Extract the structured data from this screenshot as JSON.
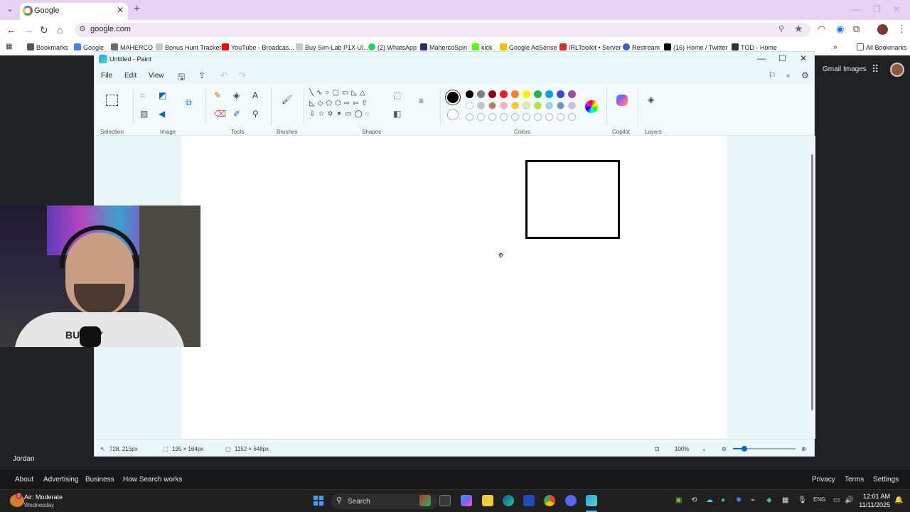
{
  "browser": {
    "tab_title": "Google",
    "url": "google.com",
    "bookmarks": [
      {
        "label": "Bookmarks",
        "color": "#555555"
      },
      {
        "label": "Google",
        "color": "#4285f4"
      },
      {
        "label": "MAHERCO",
        "color": "#6c6c6c"
      },
      {
        "label": "Bonus Hunt Tracker",
        "color": "#c9c9c9"
      },
      {
        "label": "YouTube - Broadcas...",
        "color": "#ff0000"
      },
      {
        "label": "Buy Sim-Lab P1X Ul...",
        "color": "#c9c9c9"
      },
      {
        "label": "(2) WhatsApp",
        "color": "#25d366"
      },
      {
        "label": "MahercoSpin",
        "color": "#2b2b6e"
      },
      {
        "label": "kick",
        "color": "#53fc18"
      },
      {
        "label": "Google AdSense",
        "color": "#fbbc05"
      },
      {
        "label": "IRLToolkit • Server",
        "color": "#d82c2c"
      },
      {
        "label": "Restream",
        "color": "#3b5bdb"
      },
      {
        "label": "(16) Home / Twitter",
        "color": "#000000"
      },
      {
        "label": "TOD - Home",
        "color": "#333333"
      }
    ],
    "all_bookmarks": "All Bookmarks"
  },
  "google": {
    "gmail": "Gmail",
    "images": "Images",
    "location": "Jordan",
    "footer_left": [
      "About",
      "Advertising",
      "Business",
      "How Search works"
    ],
    "footer_right": [
      "Privacy",
      "Terms",
      "Settings"
    ]
  },
  "paint": {
    "title": "Untitled - Paint",
    "menu": [
      "File",
      "Edit",
      "View"
    ],
    "groups": [
      "Selection",
      "Image",
      "Tools",
      "Brushes",
      "Shapes",
      "Colors",
      "Copilot",
      "Layers"
    ],
    "palette_row1": [
      "#000000",
      "#7f7f7f",
      "#880015",
      "#ed1c24",
      "#ff7f27",
      "#fff200",
      "#22b14c",
      "#00a2e8",
      "#3f48cc",
      "#a349a4"
    ],
    "palette_row2": [
      "#ffffff",
      "#c3c3c3",
      "#b97a57",
      "#ffaec9",
      "#ffc90e",
      "#efe4b0",
      "#b5e61d",
      "#99d9ea",
      "#7092be",
      "#c8bfe7"
    ],
    "status": {
      "cursor_pos": "728, 215px",
      "selection_size": "195 × 164px",
      "canvas_size": "1152 × 648px",
      "zoom": "100%"
    }
  },
  "webcam": {
    "shirt_text": "BU   RRY"
  },
  "taskbar": {
    "weather_title": "Air: Moderate",
    "weather_sub": "Wednesday",
    "weather_badge": "2",
    "search": "Search",
    "lang": "ENG",
    "time": "12:01 AM",
    "date": "11/11/2025"
  }
}
